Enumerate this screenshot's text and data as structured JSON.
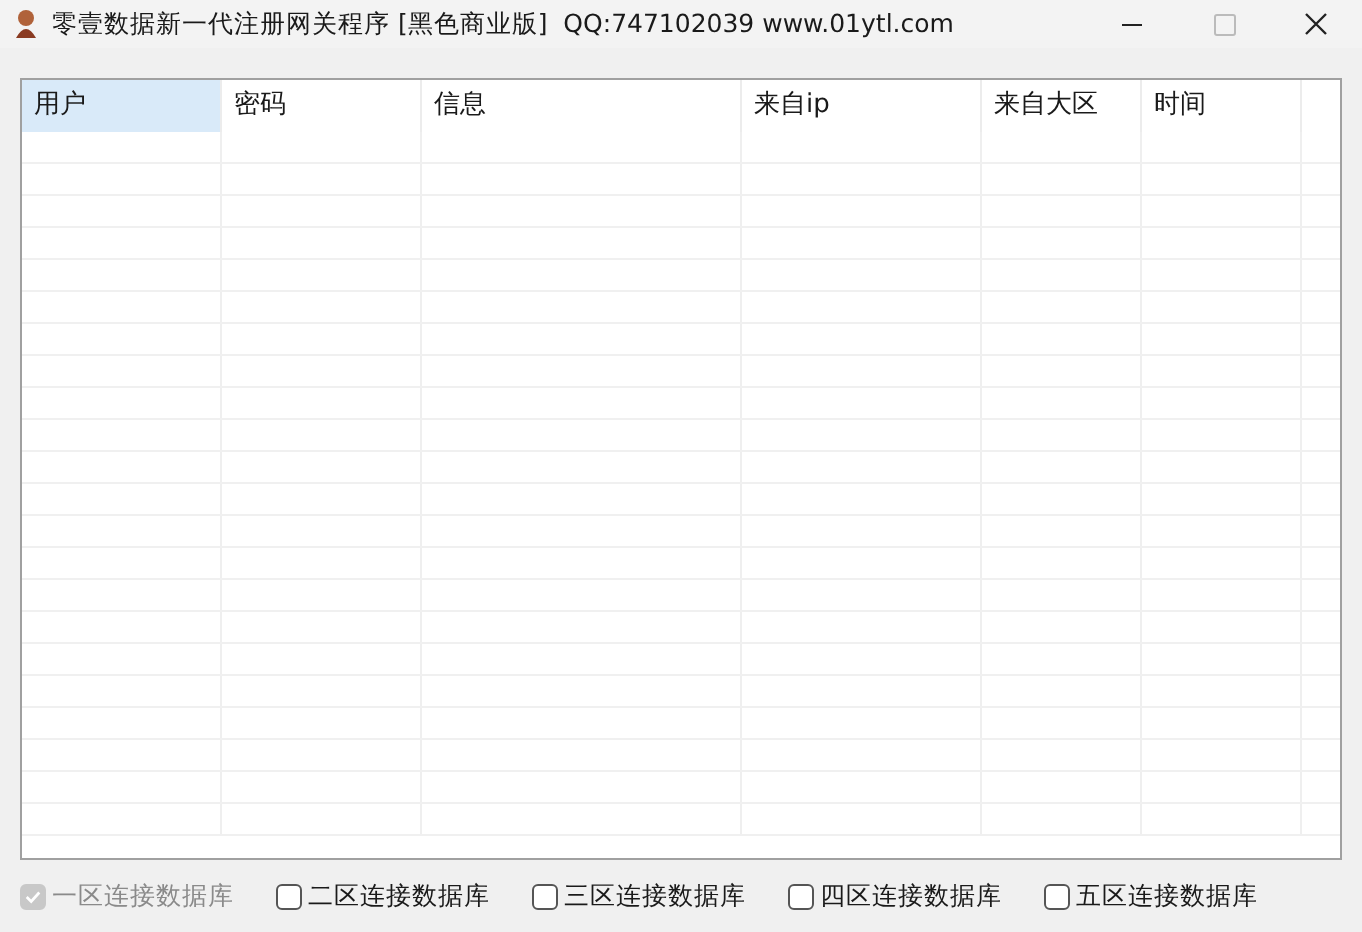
{
  "window": {
    "title": "零壹数据新一代注册网关程序 [黑色商业版]  QQ:747102039 www.01ytl.com"
  },
  "table": {
    "columns": [
      {
        "label": "用户",
        "selected": true
      },
      {
        "label": "密码",
        "selected": false
      },
      {
        "label": "信息",
        "selected": false
      },
      {
        "label": "来自ip",
        "selected": false
      },
      {
        "label": "来自大区",
        "selected": false
      },
      {
        "label": "时间",
        "selected": false
      }
    ]
  },
  "checkboxes": [
    {
      "label": "一区连接数据库",
      "checked": true,
      "disabled": true
    },
    {
      "label": "二区连接数据库",
      "checked": false,
      "disabled": false
    },
    {
      "label": "三区连接数据库",
      "checked": false,
      "disabled": false
    },
    {
      "label": "四区连接数据库",
      "checked": false,
      "disabled": false
    },
    {
      "label": "五区连接数据库",
      "checked": false,
      "disabled": false
    }
  ]
}
